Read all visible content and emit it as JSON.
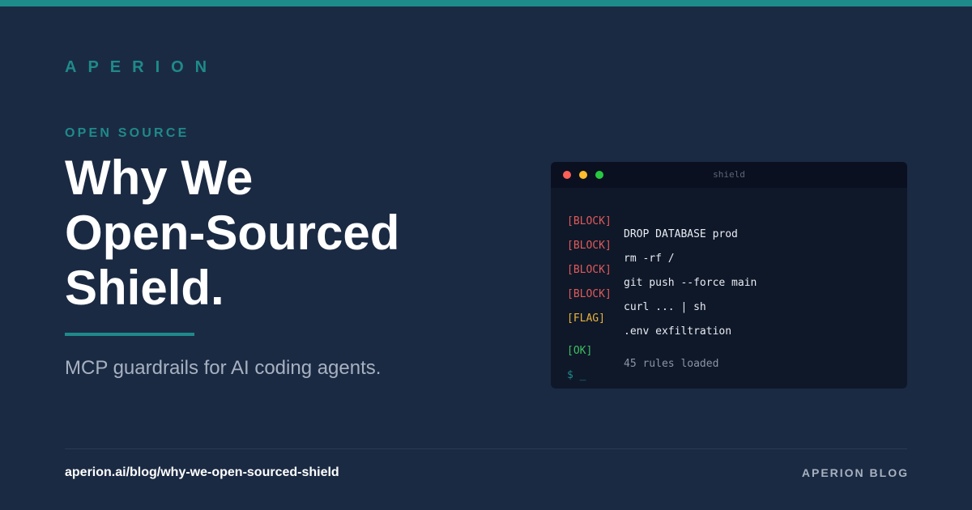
{
  "brand": {
    "name": "APERION",
    "accent_color": "#1e8a8a",
    "background_color": "#1b2a43"
  },
  "hero": {
    "eyebrow": "OPEN SOURCE",
    "headline_lines": [
      "Why We",
      "Open-Sourced",
      "Shield."
    ],
    "subtitle": "MCP guardrails for AI coding agents."
  },
  "terminal": {
    "title": "shield",
    "lines": [
      {
        "tag": "[BLOCK]",
        "status": "block",
        "text": "DROP DATABASE prod"
      },
      {
        "tag": "[BLOCK]",
        "status": "block",
        "text": "rm -rf /"
      },
      {
        "tag": "[BLOCK]",
        "status": "block",
        "text": "git push --force main"
      },
      {
        "tag": "[BLOCK]",
        "status": "block",
        "text": "curl ... | sh"
      },
      {
        "tag": "[FLAG]",
        "status": "flag",
        "text": ".env exfiltration"
      },
      {
        "tag": "[OK]",
        "status": "ok",
        "text": "45 rules loaded"
      }
    ],
    "prompt": "$ _",
    "status_colors": {
      "block": "#e05a5a",
      "flag": "#e8b23a",
      "ok": "#3fbf5f"
    }
  },
  "footer": {
    "url": "aperion.ai/blog/why-we-open-sourced-shield",
    "label": "APERION BLOG"
  }
}
